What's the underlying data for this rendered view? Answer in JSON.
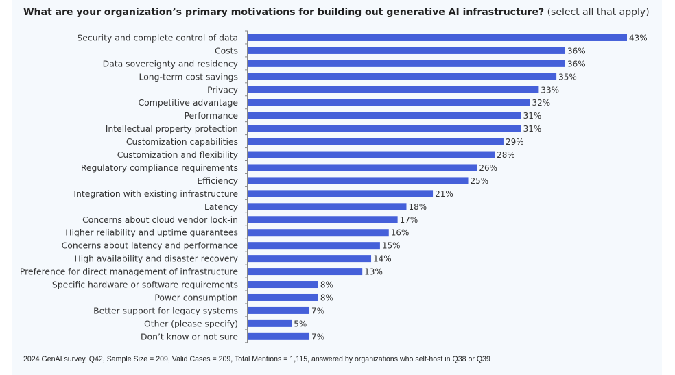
{
  "colors": {
    "bar": "#4560d9",
    "panel_background": "#f5f9fd",
    "text": "#333333",
    "axis": "#888888"
  },
  "chart_data": {
    "type": "bar",
    "orientation": "horizontal",
    "title": "What are your organization’s primary motivations for building out generative AI infrastructure?",
    "subtitle": "(select all that apply)",
    "xlabel": "",
    "ylabel": "",
    "xlim": [
      0,
      43
    ],
    "grid": false,
    "legend": "none",
    "value_suffix": "%",
    "categories": [
      "Security and complete control of data",
      "Costs",
      "Data sovereignty and residency",
      "Long-term cost savings",
      "Privacy",
      "Competitive advantage",
      "Performance",
      "Intellectual property protection",
      "Customization capabilities",
      "Customization and flexibility",
      "Regulatory compliance requirements",
      "Efficiency",
      "Integration with existing infrastructure",
      "Latency",
      "Concerns about cloud vendor lock-in",
      "Higher reliability and uptime guarantees",
      "Concerns about latency and performance",
      "High availability and disaster recovery",
      "Preference for direct management of infrastructure",
      "Specific hardware or software requirements",
      "Power consumption",
      "Better support for legacy systems",
      "Other (please specify)",
      "Don’t know or not sure"
    ],
    "values": [
      43,
      36,
      36,
      35,
      33,
      32,
      31,
      31,
      29,
      28,
      26,
      25,
      21,
      18,
      17,
      16,
      15,
      14,
      13,
      8,
      8,
      7,
      5,
      7
    ],
    "value_labels": [
      "43%",
      "36%",
      "36%",
      "35%",
      "33%",
      "32%",
      "31%",
      "31%",
      "29%",
      "28%",
      "26%",
      "25%",
      "21%",
      "18%",
      "17%",
      "16%",
      "15%",
      "14%",
      "13%",
      "8%",
      "8%",
      "7%",
      "5%",
      "7%"
    ],
    "footnote": "2024 GenAI survey, Q42, Sample Size = 209, Valid Cases = 209, Total Mentions = 1,115, answered by organizations who self-host in Q38 or Q39"
  }
}
